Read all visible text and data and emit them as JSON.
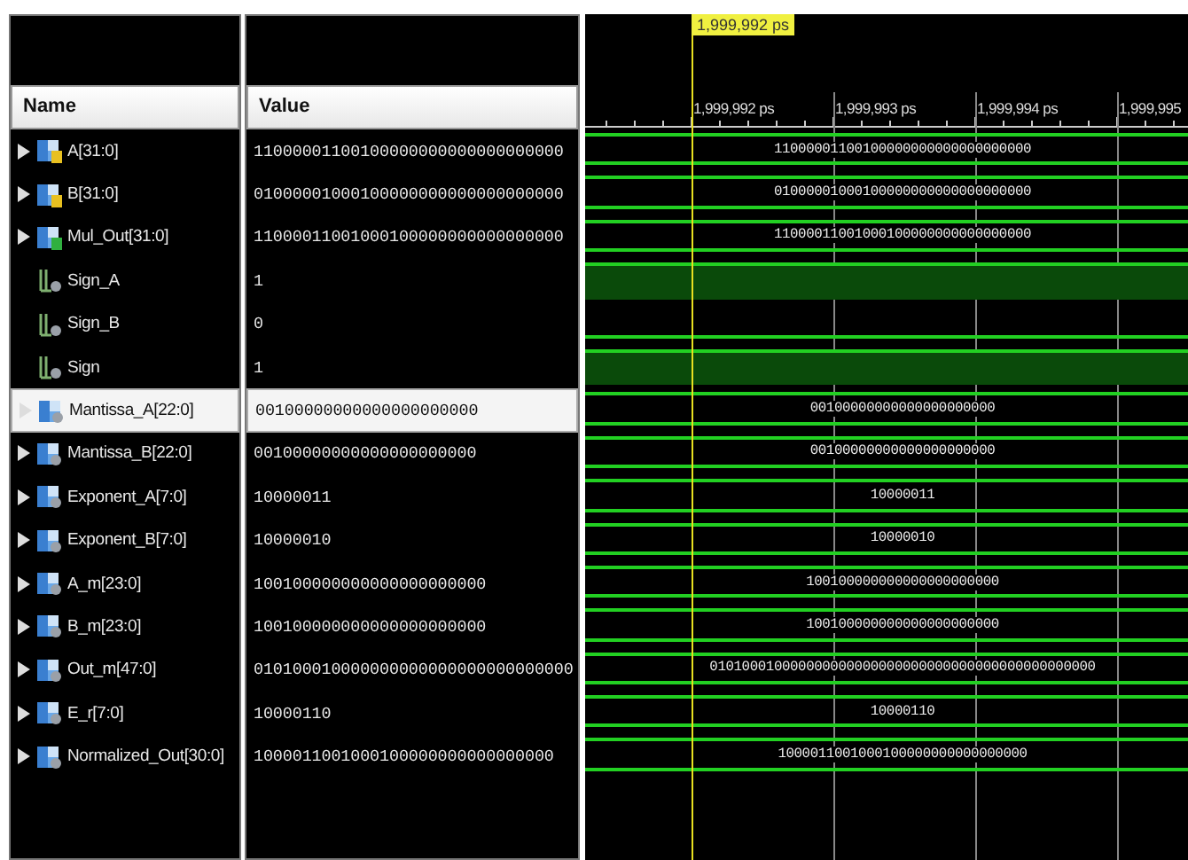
{
  "columns": {
    "name": "Name",
    "value": "Value"
  },
  "cursor": {
    "label": "1,999,992 ps"
  },
  "ruler": {
    "ticks": [
      "1,999,992 ps",
      "1,999,993 ps",
      "1,999,994 ps",
      "1,999,995"
    ]
  },
  "signals": [
    {
      "name": "A[31:0]",
      "kind": "input",
      "value": "11000001100100000000000000000000",
      "wave_value": "11000001100100000000000000000000",
      "selected": false
    },
    {
      "name": "B[31:0]",
      "kind": "input",
      "value": "01000001000100000000000000000000",
      "wave_value": "01000001000100000000000000000000",
      "selected": false
    },
    {
      "name": "Mul_Out[31:0]",
      "kind": "output",
      "value": "11000011001000100000000000000000",
      "wave_value": "11000011001000100000000000000000",
      "selected": false
    },
    {
      "name": "Sign_A",
      "kind": "wire",
      "value": "1",
      "high": true,
      "selected": false
    },
    {
      "name": "Sign_B",
      "kind": "wire",
      "value": "0",
      "high": false,
      "selected": false
    },
    {
      "name": "Sign",
      "kind": "wire",
      "value": "1",
      "high": true,
      "selected": false
    },
    {
      "name": "Mantissa_A[22:0]",
      "kind": "bus",
      "value": "00100000000000000000000",
      "wave_value": "00100000000000000000000",
      "selected": true
    },
    {
      "name": "Mantissa_B[22:0]",
      "kind": "bus",
      "value": "00100000000000000000000",
      "wave_value": "00100000000000000000000",
      "selected": false
    },
    {
      "name": "Exponent_A[7:0]",
      "kind": "bus",
      "value": "10000011",
      "wave_value": "10000011",
      "selected": false
    },
    {
      "name": "Exponent_B[7:0]",
      "kind": "bus",
      "value": "10000010",
      "wave_value": "10000010",
      "selected": false
    },
    {
      "name": "A_m[23:0]",
      "kind": "bus",
      "value": "100100000000000000000000",
      "wave_value": "100100000000000000000000",
      "selected": false
    },
    {
      "name": "B_m[23:0]",
      "kind": "bus",
      "value": "100100000000000000000000",
      "wave_value": "100100000000000000000000",
      "selected": false
    },
    {
      "name": "Out_m[47:0]",
      "kind": "bus",
      "value": "010100010000000000000000000000000",
      "wave_value": "010100010000000000000000000000000000000000000000",
      "selected": false
    },
    {
      "name": "E_r[7:0]",
      "kind": "bus",
      "value": "10000110",
      "wave_value": "10000110",
      "selected": false
    },
    {
      "name": "Normalized_Out[30:0]",
      "kind": "bus",
      "value": "1000011001000100000000000000000",
      "wave_value": "1000011001000100000000000000000",
      "selected": false
    }
  ]
}
